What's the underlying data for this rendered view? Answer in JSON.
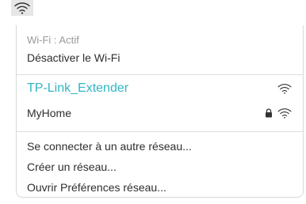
{
  "menubar": {
    "icon": "wifi-icon"
  },
  "menu": {
    "status": "Wi-Fi : Actif",
    "toggle": "Désactiver le Wi-Fi",
    "networks": [
      {
        "name": "TP-Link_Extender",
        "secured": false,
        "icon": "wifi-icon",
        "color": "#2fb6c4"
      },
      {
        "name": "MyHome",
        "secured": true,
        "icon": "wifi-icon",
        "lock_icon": "lock-icon"
      }
    ],
    "actions": [
      "Se connecter à un autre réseau...",
      "Créer un réseau...",
      "Ouvrir Préférences réseau..."
    ]
  }
}
